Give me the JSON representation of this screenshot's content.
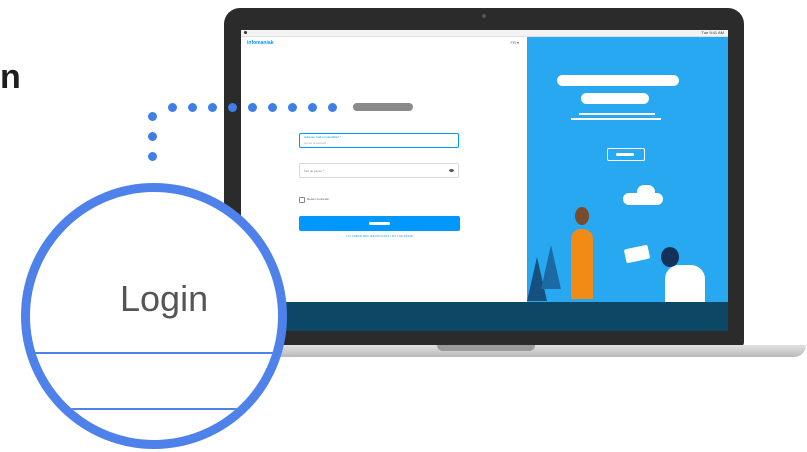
{
  "heading_fragment": "n",
  "laptop": {
    "menubar": {
      "status_text": "Tue 9:41 AM"
    },
    "login_page": {
      "brand": "infomaniak",
      "language": "FR ▾",
      "email_field": {
        "label": "Adresse mail ou identifiant *",
        "placeholder": "[email protected]"
      },
      "password_field": {
        "placeholder": "Mot de passe *"
      },
      "remember_label": "Rester connecté",
      "forgot_link": "J'AI OUBLIÉ MES IDENTIFIANTS / MOT DE PASSE"
    }
  },
  "magnifier": {
    "label": "Login"
  },
  "colors": {
    "accent": "#0098ff",
    "magnifier_ring": "#4f81ea",
    "promo_bg": "#29a8f2",
    "footer": "#0c4866"
  }
}
